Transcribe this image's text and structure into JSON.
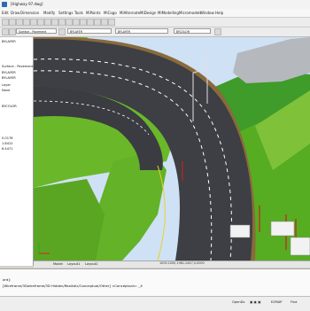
{
  "window": {
    "title": "[Highway 97.dwg]"
  },
  "menu": [
    "Edit",
    "Draw",
    "Dimension",
    "Modify",
    "Settings",
    "Tools",
    "MiPoints",
    "MiCogo",
    "MiAlternate",
    "MiDesign",
    "MiModelling",
    "Micromodels",
    "Window",
    "Help"
  ],
  "toolbar": {
    "layer_combo": "Surface - Pavement",
    "bylayer_1": "BYLAYER",
    "bylayer_2": "BYLAYER",
    "color_combo": "BYCOLOR"
  },
  "sidebar": {
    "lines": [
      "BYLAYER",
      "Surface - Pavement",
      "BYLAYER",
      "BYLAYER",
      "Layer",
      "None",
      "",
      "BYCOLOR",
      "",
      "0.0178",
      "1.8412",
      "6.4471"
    ]
  },
  "tabs": [
    "Model",
    "Layout1",
    "Layout2"
  ],
  "coords": "1000.1000,1981.2447,0.0000",
  "command": {
    "line1": "ard]:",
    "line2": "[Wireframe/3Dwireframe/3D Hidden/Realistic/Conceptual/Other] <Conceptual>: _X"
  },
  "status": {
    "opendx": "OpenDx",
    "ezmap": "EZMAP",
    "find": "Find"
  },
  "colors": {
    "grass": "#6ab82a",
    "road": "#3d3f44",
    "sky": "#cfe1f5",
    "accent": "#2b6cb0"
  }
}
